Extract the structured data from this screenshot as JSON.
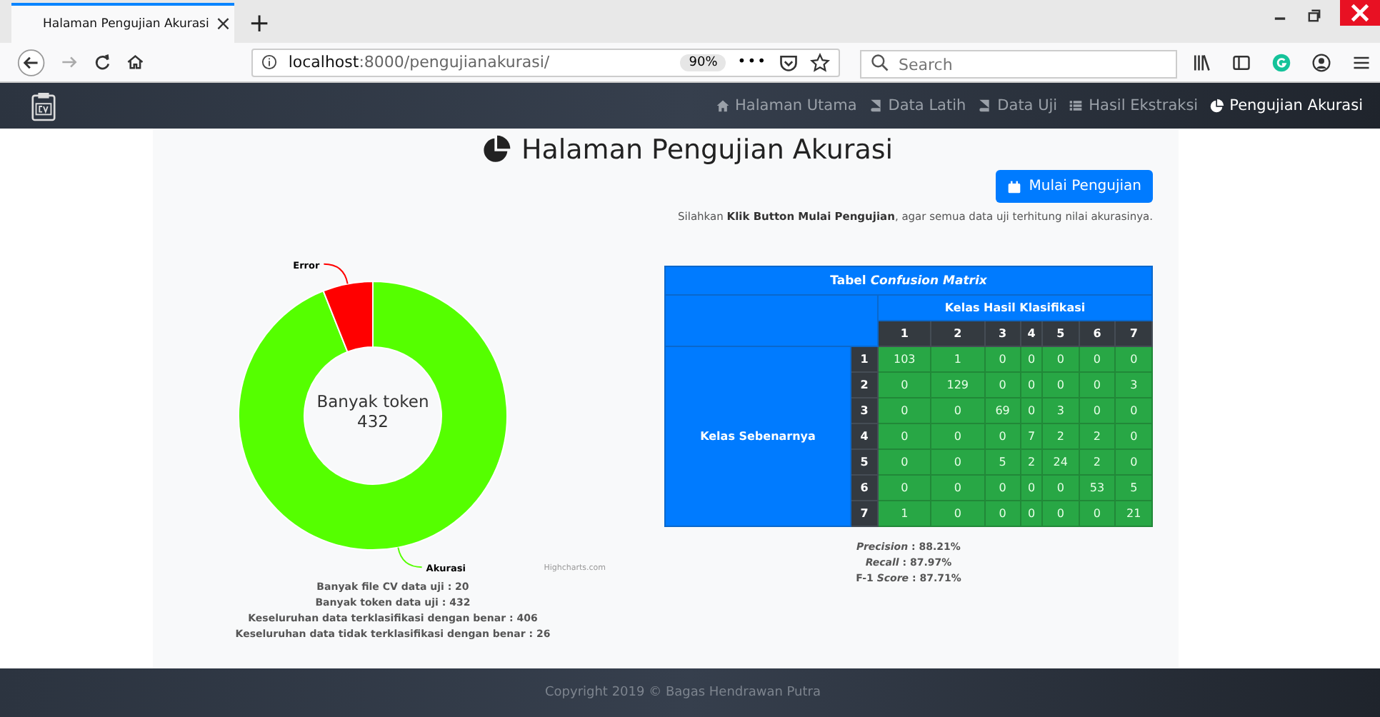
{
  "browser": {
    "tab": {
      "title": "Halaman Pengujian Akurasi",
      "close": "×"
    },
    "new_tab": "+",
    "url": {
      "host": "localhost",
      "path": ":8000/pengujianakurasi/"
    },
    "zoom": "90%",
    "more": "•••",
    "search": {
      "placeholder": "Search"
    }
  },
  "navbar": {
    "items": [
      {
        "label": "Halaman Utama",
        "kind": "home",
        "selected": false
      },
      {
        "label": "Data Latih",
        "kind": "book",
        "selected": false
      },
      {
        "label": "Data Uji",
        "kind": "book",
        "selected": false
      },
      {
        "label": "Hasil Ekstraksi",
        "kind": "list",
        "selected": false
      },
      {
        "label": "Pengujian Akurasi",
        "kind": "pie",
        "selected": true
      }
    ]
  },
  "page": {
    "title": "Halaman Pengujian Akurasi",
    "button": "Mulai Pengujian",
    "instruction": "Silahkan **Klik Button Mulai Pengujian**, agar semua data uji terhitung nilai akurasinya."
  },
  "donut": {
    "center_label": [
      "Banyak token",
      "432"
    ],
    "credits": "Highcharts.com",
    "chart_data": {
      "type": "donut",
      "categories": [
        "Akurasi",
        "Error"
      ],
      "series": [
        {
          "values": [
            93.98,
            6.02
          ]
        }
      ],
      "colors": [
        "#55ff00",
        "#ff0000"
      ]
    }
  },
  "stats": [
    "Banyak file CV data uji : 20",
    "Banyak token data uji : 432",
    "Keseluruhan data terklasifikasi dengan benar : 406",
    "Keseluruhan data tidak terklasifikasi dengan benar : 26"
  ],
  "matrix": {
    "title": "Tabel *Confusion Matrix*",
    "col_group": "Kelas Hasil Klasifikasi",
    "row_group": "Kelas Sebenarnya",
    "columns": [
      "1",
      "2",
      "3",
      "4",
      "5",
      "6",
      "7"
    ],
    "rows": [
      {
        "label": "1",
        "cells": [
          "103",
          "1",
          "0",
          "0",
          "0",
          "0",
          "0"
        ]
      },
      {
        "label": "2",
        "cells": [
          "0",
          "129",
          "0",
          "0",
          "0",
          "0",
          "3"
        ]
      },
      {
        "label": "3",
        "cells": [
          "0",
          "0",
          "69",
          "0",
          "3",
          "0",
          "0"
        ]
      },
      {
        "label": "4",
        "cells": [
          "0",
          "0",
          "0",
          "7",
          "2",
          "2",
          "0"
        ]
      },
      {
        "label": "5",
        "cells": [
          "0",
          "0",
          "5",
          "2",
          "24",
          "2",
          "0"
        ]
      },
      {
        "label": "6",
        "cells": [
          "0",
          "0",
          "0",
          "0",
          "0",
          "53",
          "5"
        ]
      },
      {
        "label": "7",
        "cells": [
          "1",
          "0",
          "0",
          "0",
          "0",
          "0",
          "21"
        ]
      }
    ]
  },
  "metrics": [
    "*Precision* : 88.21%",
    "*Recall* : 87.97%",
    "F-1 *Score* : 87.71%"
  ],
  "footer": "Copyright 2019 © Bagas Hendrawan Putra"
}
